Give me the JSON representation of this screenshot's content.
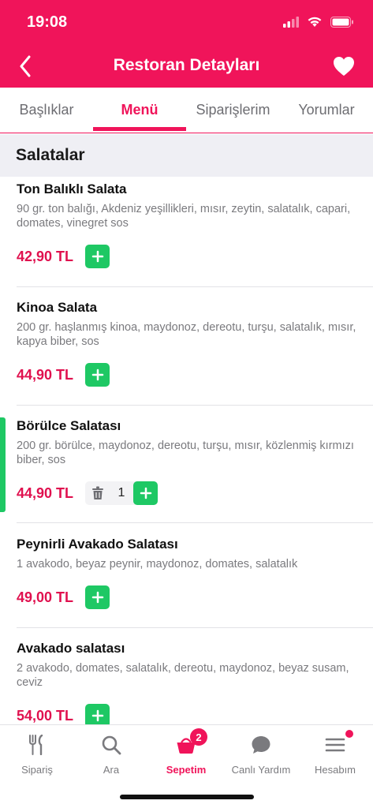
{
  "status": {
    "time": "19:08"
  },
  "header": {
    "title": "Restoran Detayları"
  },
  "tabs": [
    {
      "label": "Başlıklar"
    },
    {
      "label": "Menü"
    },
    {
      "label": "Siparişlerim"
    },
    {
      "label": "Yorumlar"
    }
  ],
  "section": {
    "title": "Salatalar"
  },
  "items": [
    {
      "name": "Ton Balıklı Salata",
      "desc": "90 gr. ton balığı, Akdeniz yeşillikleri, mısır, zeytin, salatalık, capari, domates, vinegret sos",
      "price": "42,90 TL"
    },
    {
      "name": "Kinoa Salata",
      "desc": "200 gr. haşlanmış kinoa, maydonoz, dereotu, turşu, salatalık, mısır, kapya biber, sos",
      "price": "44,90 TL"
    },
    {
      "name": "Börülce Salatası",
      "desc": "200 gr. börülce, maydonoz, dereotu, turşu, mısır, közlenmiş kırmızı biber, sos",
      "price": "44,90 TL",
      "quantity": "1"
    },
    {
      "name": "Peynirli Avakado Salatası",
      "desc": "1 avakodo, beyaz peynir, maydonoz, domates, salatalık",
      "price": "49,00 TL"
    },
    {
      "name": "Avakado salatası",
      "desc": "2 avakodo, domates, salatalık, dereotu, maydonoz, beyaz susam, ceviz",
      "price": "54,00 TL"
    }
  ],
  "tabbar": {
    "items": [
      {
        "label": "Sipariş",
        "icon": "fork-knife-icon"
      },
      {
        "label": "Ara",
        "icon": "search-icon"
      },
      {
        "label": "Sepetim",
        "icon": "basket-icon",
        "badge": "2"
      },
      {
        "label": "Canlı Yardım",
        "icon": "chat-bubble-icon"
      },
      {
        "label": "Hesabım",
        "icon": "menu-icon"
      }
    ]
  },
  "colors": {
    "brand": "#f0145a",
    "add": "#1ec864",
    "price": "#e0114f"
  }
}
